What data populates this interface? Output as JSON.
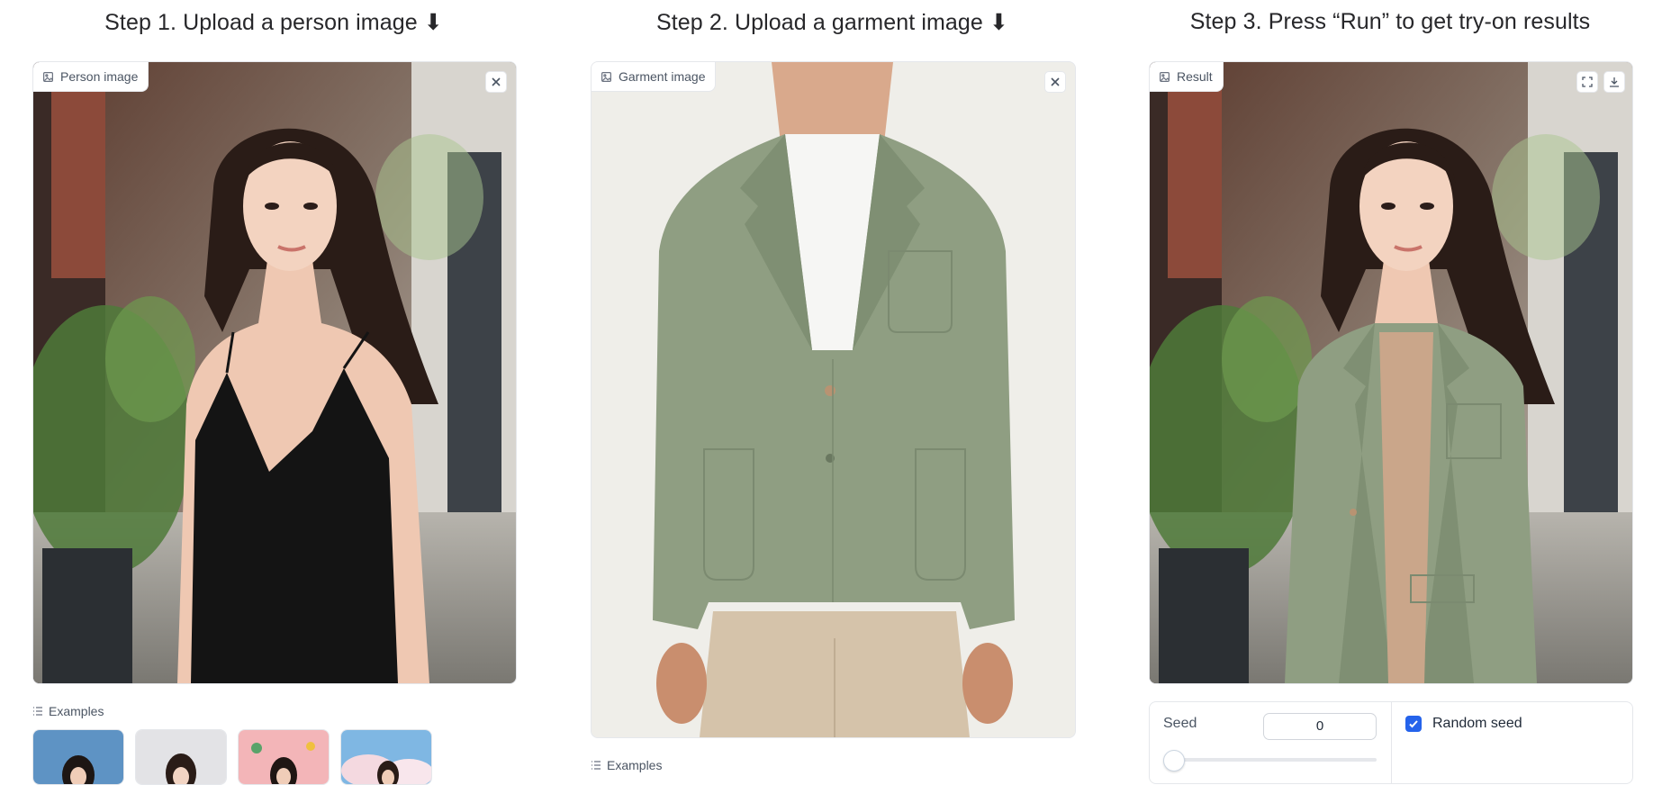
{
  "steps": [
    {
      "title": "Step 1. Upload a person image ⬇",
      "panel_label": "Person image"
    },
    {
      "title": "Step 2. Upload a garment image ⬇",
      "panel_label": "Garment image"
    },
    {
      "title": "Step 3. Press “Run” to get try-on results",
      "panel_label": "Result"
    }
  ],
  "examples_label": "Examples",
  "settings": {
    "seed_label": "Seed",
    "seed_value": "0",
    "random_seed_label": "Random seed",
    "random_seed_checked": true
  },
  "icons": [
    "image-icon",
    "close-icon",
    "fullscreen-icon",
    "download-icon",
    "list-icon",
    "check-icon"
  ],
  "colors": {
    "accent": "#2563eb",
    "jacket": "#8f9e82",
    "border": "#e5e7eb"
  }
}
